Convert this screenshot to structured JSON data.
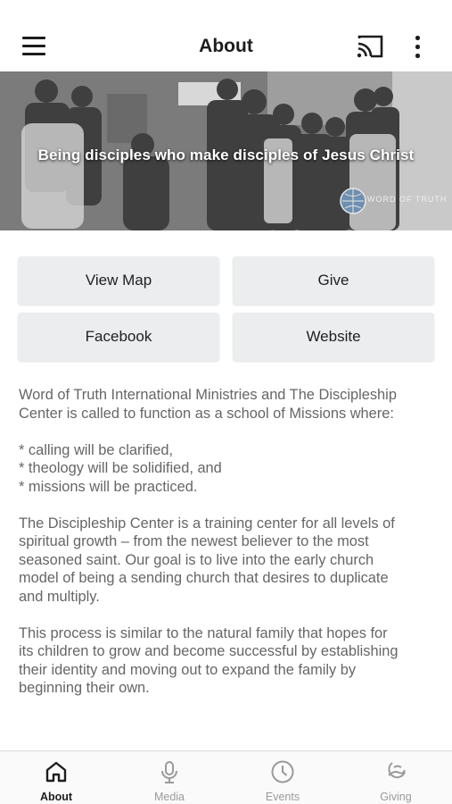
{
  "header": {
    "title": "About",
    "menu_icon": "hamburger-menu-icon",
    "cast_icon": "cast-icon",
    "more_icon": "more-vertical-icon"
  },
  "hero": {
    "tagline": "Being disciples who make disciples of Jesus Christ",
    "logo_text": "WORD OF TRUTH"
  },
  "actions": {
    "view_map": "View Map",
    "give": "Give",
    "facebook": "Facebook",
    "website": "Website"
  },
  "content": {
    "paragraph_1_line_1": "Word of Truth International Ministries and The Discipleship",
    "paragraph_1_line_2": "Center is called to function as a school of Missions where:",
    "bullet_1": "* calling will be clarified,",
    "bullet_2": "* theology will be solidified, and",
    "bullet_3": "* missions will be practiced.",
    "paragraph_2_line_1": "The Discipleship Center is a training center for all levels of",
    "paragraph_2_line_2": "spiritual growth – from the newest believer to the most",
    "paragraph_2_line_3": "seasoned saint.  Our goal is to live into the early church",
    "paragraph_2_line_4": "model of being a sending church that desires to duplicate",
    "paragraph_2_line_5": "and multiply.",
    "paragraph_3_line_1": "This process is similar to the natural family that hopes for",
    "paragraph_3_line_2": "its children to grow and become successful by establishing",
    "paragraph_3_line_3": "their identity and moving out to expand the family by",
    "paragraph_3_line_4": "beginning their own."
  },
  "tabs": [
    {
      "label": "About",
      "icon": "home-icon",
      "active": true
    },
    {
      "label": "Media",
      "icon": "microphone-icon",
      "active": false
    },
    {
      "label": "Events",
      "icon": "clock-icon",
      "active": false
    },
    {
      "label": "Giving",
      "icon": "giving-icon",
      "active": false
    }
  ],
  "colors": {
    "active_tab": "#1d1d1d",
    "inactive_tab": "#9a9a9a",
    "button_bg": "#ebedee",
    "body_text": "#666666"
  }
}
